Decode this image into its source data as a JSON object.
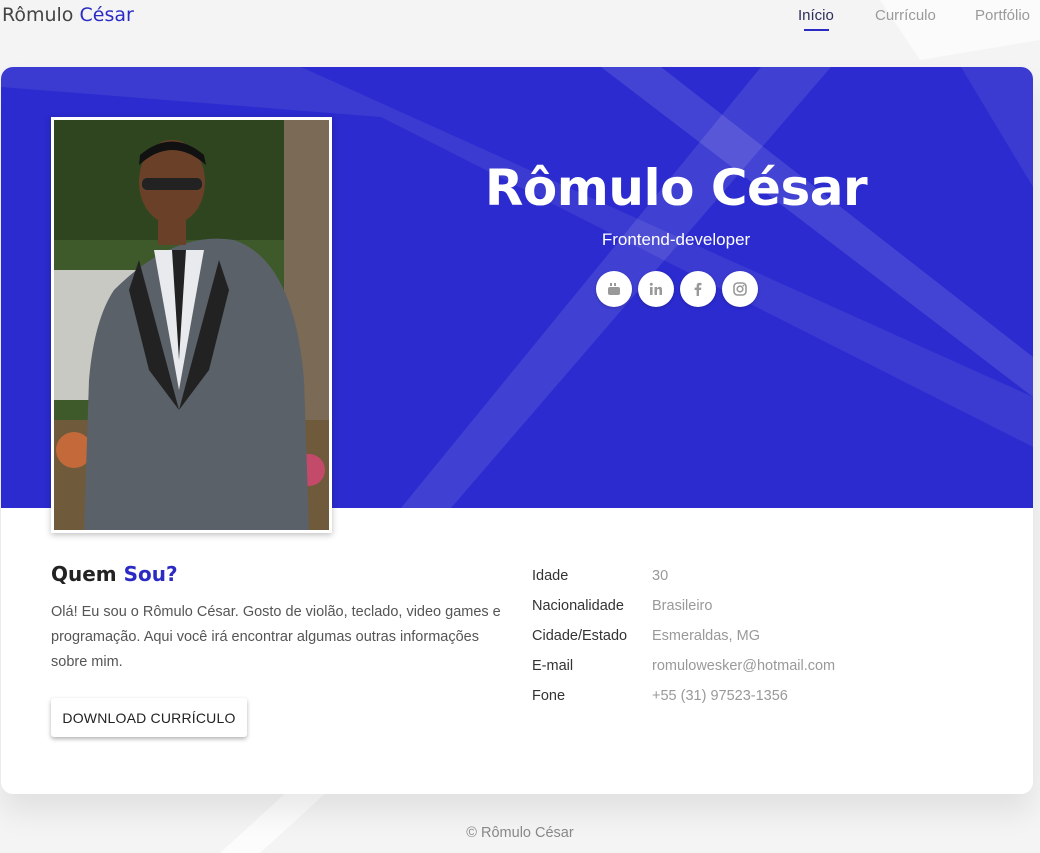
{
  "brand": {
    "first": "Rômulo",
    "last": "César"
  },
  "nav": {
    "items": [
      {
        "label": "Início",
        "active": true
      },
      {
        "label": "Currículo",
        "active": false
      },
      {
        "label": "Portfólio",
        "active": false
      }
    ]
  },
  "hero": {
    "name": "Rômulo César",
    "role": "Frontend-developer",
    "photo_icon": "portrait-photo",
    "socials": [
      {
        "icon": "youtube-icon"
      },
      {
        "icon": "linkedin-icon"
      },
      {
        "icon": "facebook-icon"
      },
      {
        "icon": "instagram-icon"
      }
    ]
  },
  "about": {
    "title_first": "Quem",
    "title_accent": "Sou?",
    "text": "Olá! Eu sou o Rômulo César. Gosto de violão, teclado, video games e programação. Aqui você irá encontrar algumas outras informações sobre mim.",
    "download_label": "DOWNLOAD CURRÍCULO"
  },
  "info": [
    {
      "label": "Idade",
      "value": "30"
    },
    {
      "label": "Nacionalidade",
      "value": "Brasileiro"
    },
    {
      "label": "Cidade/Estado",
      "value": "Esmeraldas, MG"
    },
    {
      "label": "E-mail",
      "value": "romulowesker@hotmail.com"
    },
    {
      "label": "Fone",
      "value": "+55 (31) 97523-1356"
    }
  ],
  "footer": {
    "text": "© Rômulo César"
  },
  "colors": {
    "accent": "#2b2bc4",
    "hero_bg": "#2b2bcf",
    "page_bg": "#f4f4f5"
  }
}
